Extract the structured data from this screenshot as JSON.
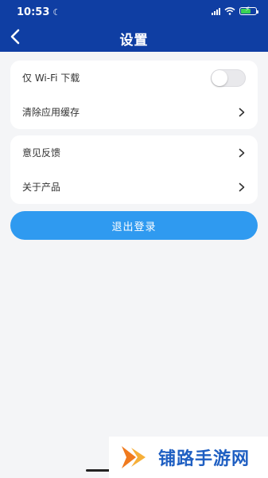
{
  "status_bar": {
    "time": "10:53"
  },
  "header": {
    "title": "设置"
  },
  "settings": {
    "group1": [
      {
        "label": "仅 Wi-Fi 下载",
        "control": "toggle",
        "on": false
      },
      {
        "label": "清除应用缓存",
        "control": "chevron"
      }
    ],
    "group2": [
      {
        "label": "意见反馈",
        "control": "chevron"
      },
      {
        "label": "关于产品",
        "control": "chevron"
      }
    ]
  },
  "logout_label": "退出登录",
  "watermark": {
    "text": "铺路手游网"
  },
  "colors": {
    "header": "#0f3ea3",
    "button": "#2f9af0",
    "background": "#f4f5f7",
    "watermark": "#1f5fc2"
  }
}
